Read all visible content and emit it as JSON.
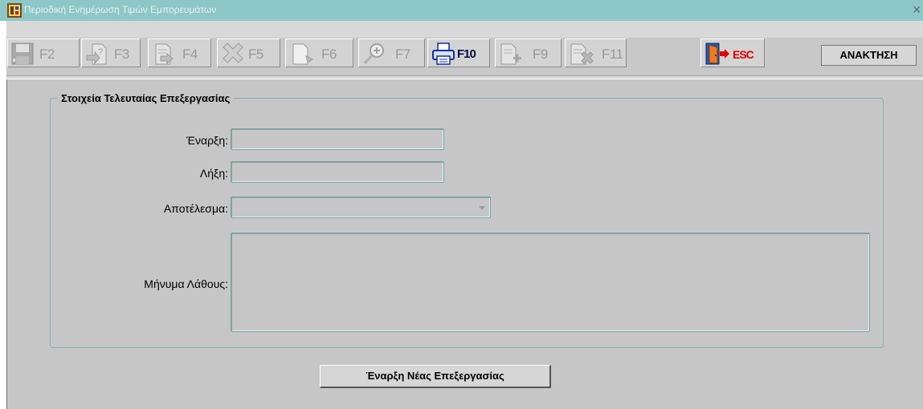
{
  "window": {
    "title": "Περιοδική Ενημέρωση Τιμών Εμπορευμάτων",
    "close_glyph": "×"
  },
  "toolbar": {
    "buttons": [
      {
        "key": "F2",
        "icon": "save-icon",
        "enabled": false
      },
      {
        "key": "F3",
        "icon": "query-icon",
        "enabled": false
      },
      {
        "key": "F4",
        "icon": "execute-query-icon",
        "enabled": false
      },
      {
        "key": "F5",
        "icon": "delete-record-icon",
        "enabled": false
      },
      {
        "key": "F6",
        "icon": "new-record-icon",
        "enabled": false
      },
      {
        "key": "F7",
        "icon": "zoom-search-icon",
        "enabled": false
      },
      {
        "key": "F10",
        "icon": "print-icon",
        "enabled": true
      },
      {
        "key": "F9",
        "icon": "insert-record-icon",
        "enabled": false
      },
      {
        "key": "F11",
        "icon": "remove-record-icon",
        "enabled": false
      },
      {
        "key": "ESC",
        "icon": "exit-door-icon",
        "enabled": true
      }
    ],
    "retrieve_label": "ΑΝΑΚΤΗΣΗ"
  },
  "group": {
    "title": "Στοιχεία Τελευταίας Επεξεργασίας",
    "start_label": "Έναρξη:",
    "start_value": "",
    "end_label": "Λήξη:",
    "end_value": "",
    "result_label": "Αποτέλεσμα:",
    "result_value": "",
    "error_label": "Μήνυμα Λάθους:",
    "error_value": ""
  },
  "actions": {
    "start_new_label": "Έναρξη Νέας Επεξεργασίας"
  },
  "colors": {
    "titlebar": "#8ec7c7",
    "panel": "#c6c6c6",
    "field_border": "#6ea8a8",
    "esc_red": "#e00000"
  }
}
